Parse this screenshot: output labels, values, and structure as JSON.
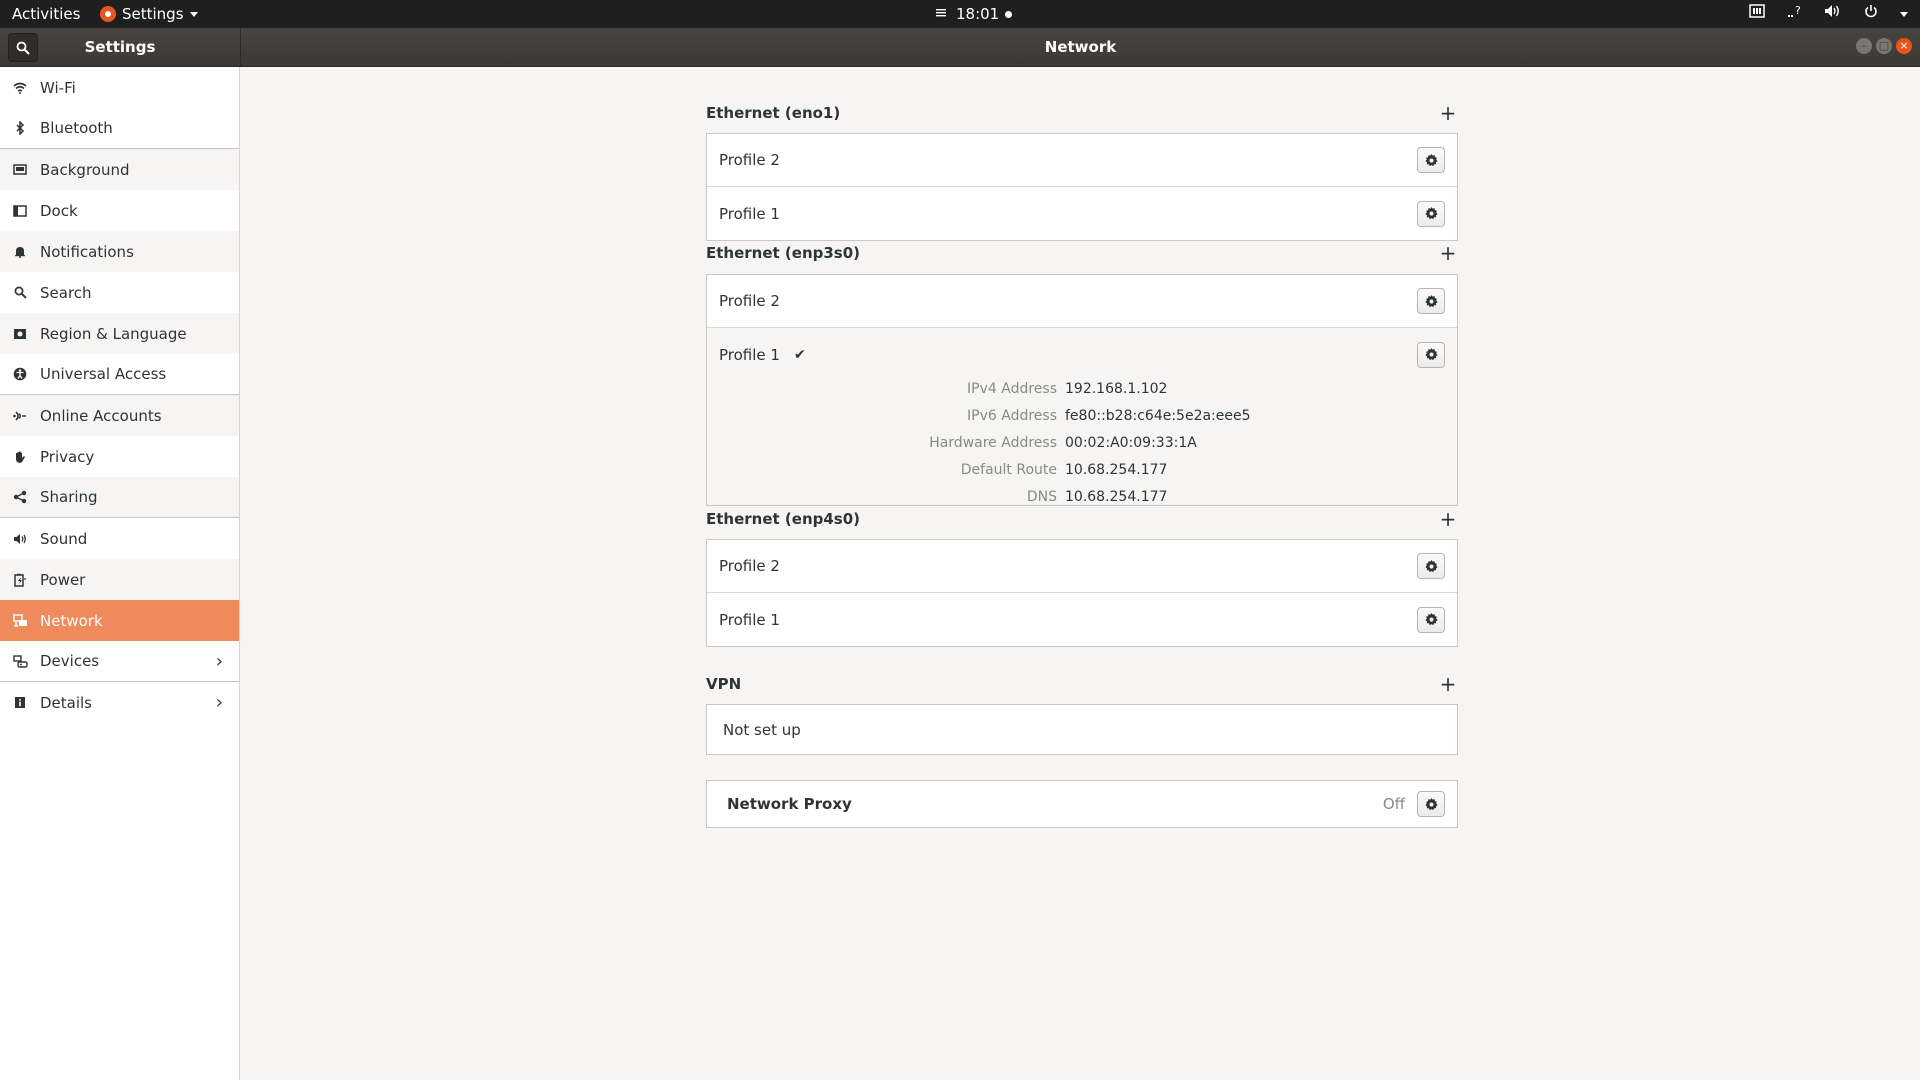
{
  "topbar": {
    "activities": "Activities",
    "app_menu": "Settings",
    "clock": "18:01",
    "tray_icons": [
      "keyboard-icon",
      "network-question-icon",
      "volume-icon",
      "power-icon"
    ]
  },
  "headerbar": {
    "left_title": "Settings",
    "title": "Network"
  },
  "sidebar": {
    "items": [
      {
        "label": "Wi-Fi",
        "icon": "wifi-icon"
      },
      {
        "label": "Bluetooth",
        "icon": "bluetooth-icon"
      },
      {
        "label": "Background",
        "icon": "background-icon"
      },
      {
        "label": "Dock",
        "icon": "dock-icon"
      },
      {
        "label": "Notifications",
        "icon": "bell-icon"
      },
      {
        "label": "Search",
        "icon": "search-icon"
      },
      {
        "label": "Region & Language",
        "icon": "region-icon"
      },
      {
        "label": "Universal Access",
        "icon": "accessibility-icon"
      },
      {
        "label": "Online Accounts",
        "icon": "online-accounts-icon"
      },
      {
        "label": "Privacy",
        "icon": "hand-icon"
      },
      {
        "label": "Sharing",
        "icon": "share-icon"
      },
      {
        "label": "Sound",
        "icon": "speaker-icon"
      },
      {
        "label": "Power",
        "icon": "power-battery-icon"
      },
      {
        "label": "Network",
        "icon": "network-icon"
      },
      {
        "label": "Devices",
        "icon": "devices-icon"
      },
      {
        "label": "Details",
        "icon": "info-icon"
      }
    ]
  },
  "network": {
    "eno1": {
      "title": "Ethernet (eno1)",
      "profiles": [
        "Profile 2",
        "Profile 1"
      ]
    },
    "enp3s0": {
      "title": "Ethernet (enp3s0)",
      "profiles": [
        "Profile 2",
        "Profile 1"
      ],
      "details": [
        {
          "key": "IPv4 Address",
          "value": "192.168.1.102"
        },
        {
          "key": "IPv6 Address",
          "value": "fe80::b28:c64e:5e2a:eee5"
        },
        {
          "key": "Hardware Address",
          "value": "00:02:A0:09:33:1A"
        },
        {
          "key": "Default Route",
          "value": "10.68.254.177"
        },
        {
          "key": "DNS",
          "value": "10.68.254.177"
        }
      ]
    },
    "enp4s0": {
      "title": "Ethernet (enp4s0)",
      "profiles": [
        "Profile 2",
        "Profile 1"
      ]
    },
    "vpn": {
      "title": "VPN",
      "status": "Not set up"
    },
    "proxy": {
      "title": "Network Proxy",
      "status": "Off"
    }
  },
  "colors": {
    "accent": "#f08a5d",
    "topbar": "#1f1f1f",
    "headerbar": "#3c3a35",
    "close_button": "#e95420"
  }
}
